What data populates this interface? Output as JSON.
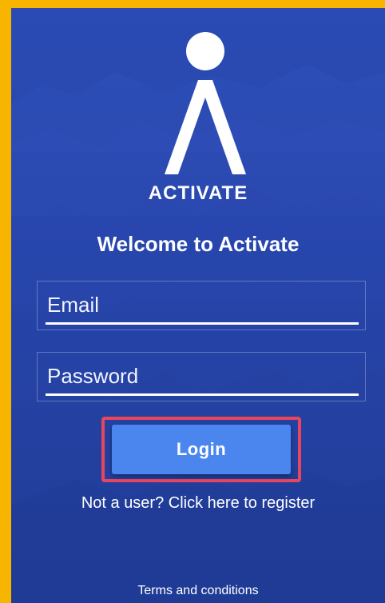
{
  "brand": {
    "name": "ACTIVATE"
  },
  "welcome": {
    "title": "Welcome to Activate"
  },
  "form": {
    "email": {
      "placeholder": "Email",
      "value": ""
    },
    "password": {
      "placeholder": "Password",
      "value": ""
    },
    "login_label": "Login"
  },
  "links": {
    "register": "Not a user? Click here to register",
    "terms": "Terms and conditions"
  },
  "colors": {
    "frame": "#f7b500",
    "background": "#2747ad",
    "button": "#4a86ee",
    "highlight": "#e8465c",
    "text": "#ffffff"
  },
  "icons": {
    "logo": "activate-figure-logo"
  }
}
